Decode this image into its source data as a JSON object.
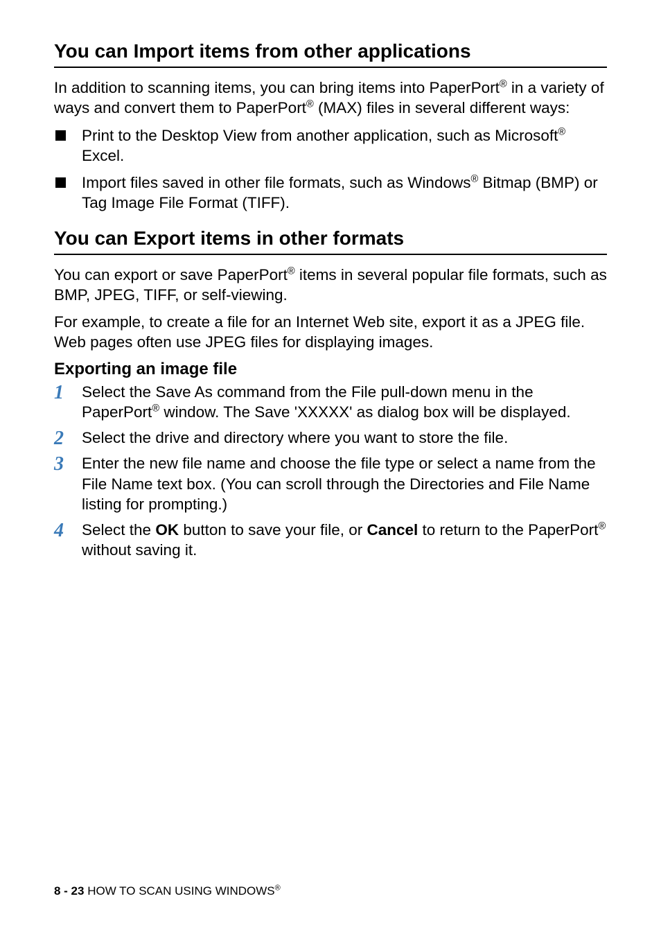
{
  "section1": {
    "title": "You can Import items from other applications",
    "intro_parts": {
      "p1": "In addition to scanning items, you can bring items into PaperPort",
      "p2": " in a variety of ways and convert them to PaperPort",
      "p3": " (MAX) files in several different ways:"
    },
    "bullets": [
      {
        "b1": "Print to the Desktop View from another application, such as Microsoft",
        "b2": " Excel."
      },
      {
        "b1": "Import files saved in other file formats, such as Windows",
        "b2": " Bitmap (BMP) or Tag Image File Format (TIFF)."
      }
    ]
  },
  "section2": {
    "title": "You can Export items in other formats",
    "para1": {
      "p1": "You can export or save PaperPort",
      "p2": " items in several popular file formats, such as BMP, JPEG, TIFF, or self-viewing."
    },
    "para2": "For example, to create a file for an Internet Web site, export it as a JPEG file. Web pages often use JPEG files for displaying images.",
    "subheading": "Exporting an image file",
    "steps": [
      {
        "s1": "Select the Save As command from the File pull-down menu in the PaperPort",
        "s2": " window. The Save 'XXXXX' as dialog box will be displayed."
      },
      {
        "s1": "Select the drive and directory where you want to store the file.",
        "s2": ""
      },
      {
        "s1": "Enter the new file name and choose the file type or select a name from the File Name text box. (You can scroll through the Directories and File Name listing for prompting.)",
        "s2": ""
      },
      {
        "pre": "Select the ",
        "ok": "OK",
        "mid": " button to save your file, or ",
        "cancel": "Cancel",
        "post1": " to return to the PaperPort",
        "post2": " without saving it."
      }
    ]
  },
  "footer": {
    "page": "8 - 23",
    "title_pre": "   HOW TO SCAN USING WINDOWS"
  },
  "reg": "®"
}
